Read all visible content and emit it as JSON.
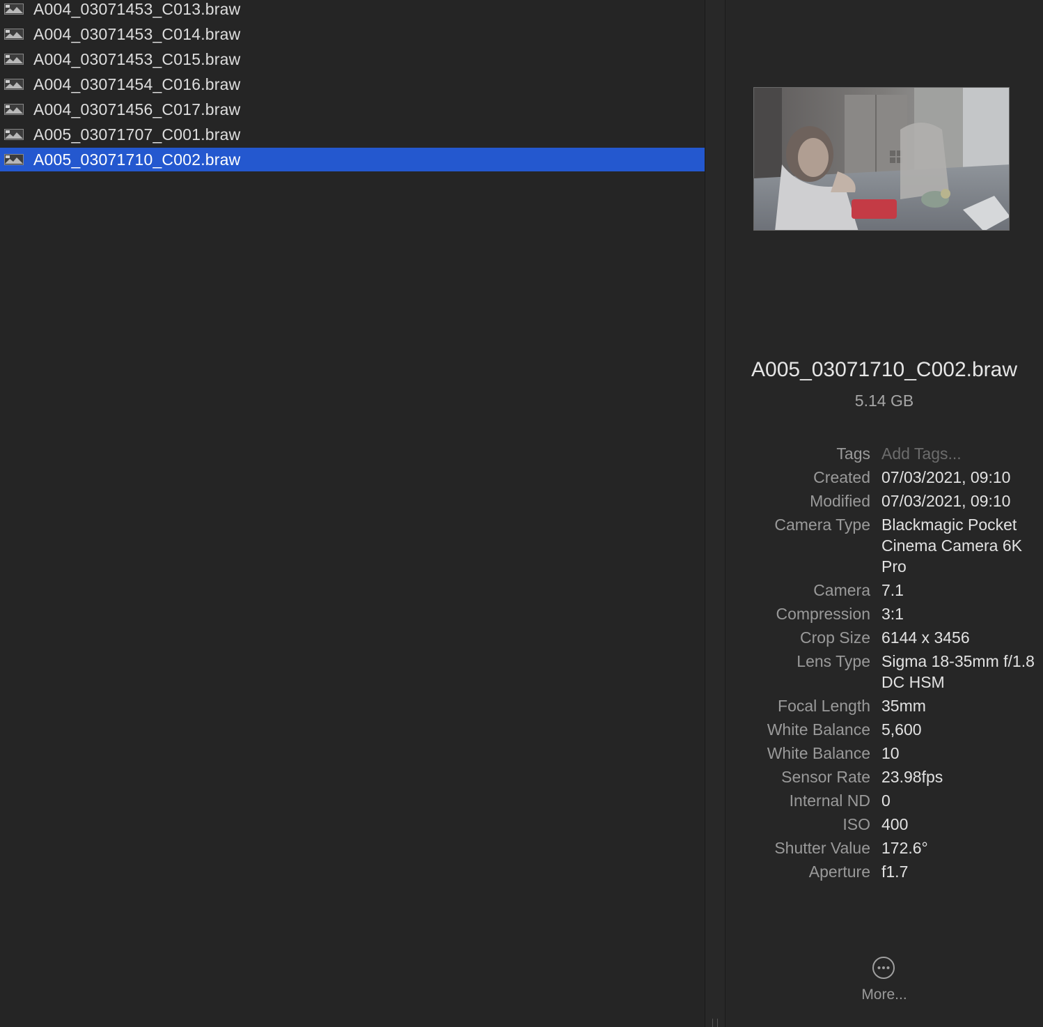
{
  "files": [
    {
      "name": "A004_03071453_C013.braw",
      "selected": false
    },
    {
      "name": "A004_03071453_C014.braw",
      "selected": false
    },
    {
      "name": "A004_03071453_C015.braw",
      "selected": false
    },
    {
      "name": "A004_03071454_C016.braw",
      "selected": false
    },
    {
      "name": "A004_03071456_C017.braw",
      "selected": false
    },
    {
      "name": "A005_03071707_C001.braw",
      "selected": false
    },
    {
      "name": "A005_03071710_C002.braw",
      "selected": true
    }
  ],
  "preview": {
    "file_name": "A005_03071710_C002.braw",
    "file_size": "5.14 GB",
    "metadata": [
      {
        "key": "Tags",
        "value": "Add Tags...",
        "placeholder": true
      },
      {
        "key": "Created",
        "value": "07/03/2021, 09:10"
      },
      {
        "key": "Modified",
        "value": "07/03/2021, 09:10"
      },
      {
        "key": "Camera Type",
        "value": "Blackmagic Pocket Cinema Camera 6K Pro"
      },
      {
        "key": "Camera",
        "value": "7.1"
      },
      {
        "key": "Compression",
        "value": "3:1"
      },
      {
        "key": "Crop Size",
        "value": "6144 x 3456"
      },
      {
        "key": "Lens Type",
        "value": "Sigma 18-35mm f/1.8 DC HSM"
      },
      {
        "key": "Focal Length",
        "value": "35mm"
      },
      {
        "key": "White Balance",
        "value": "5,600"
      },
      {
        "key": "White Balance",
        "value": "10"
      },
      {
        "key": "Sensor Rate",
        "value": "23.98fps"
      },
      {
        "key": "Internal ND",
        "value": "0"
      },
      {
        "key": "ISO",
        "value": "400"
      },
      {
        "key": "Shutter Value",
        "value": "172.6°"
      },
      {
        "key": "Aperture",
        "value": "f1.7"
      }
    ],
    "more_label": "More..."
  },
  "colors": {
    "selection": "#2458cf",
    "background": "#252525"
  }
}
